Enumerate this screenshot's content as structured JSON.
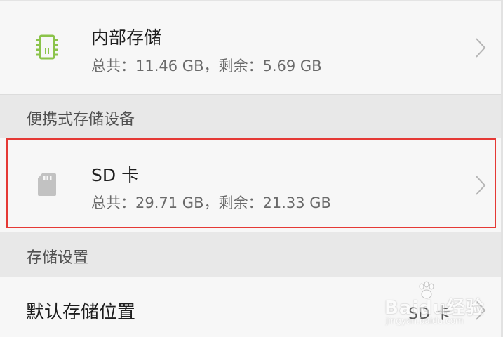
{
  "internal_storage": {
    "title": "内部存储",
    "summary": "总共：11.46 GB，剩余：5.69 GB",
    "icon": "chip-icon",
    "icon_color": "#8bc34a"
  },
  "portable_section": {
    "label": "便携式存储设备"
  },
  "sd_card": {
    "title": "SD 卡",
    "summary": "总共：29.71 GB，剩余：21.33 GB",
    "icon": "sd-card-icon",
    "icon_color": "#c2c2c2",
    "highlight_color": "#e53935"
  },
  "settings_section": {
    "label": "存储设置"
  },
  "default_location": {
    "label": "默认存储位置",
    "value": "SD 卡"
  },
  "watermark": {
    "text": "Baidu经验",
    "sub": "jingyan.baidu.com"
  }
}
